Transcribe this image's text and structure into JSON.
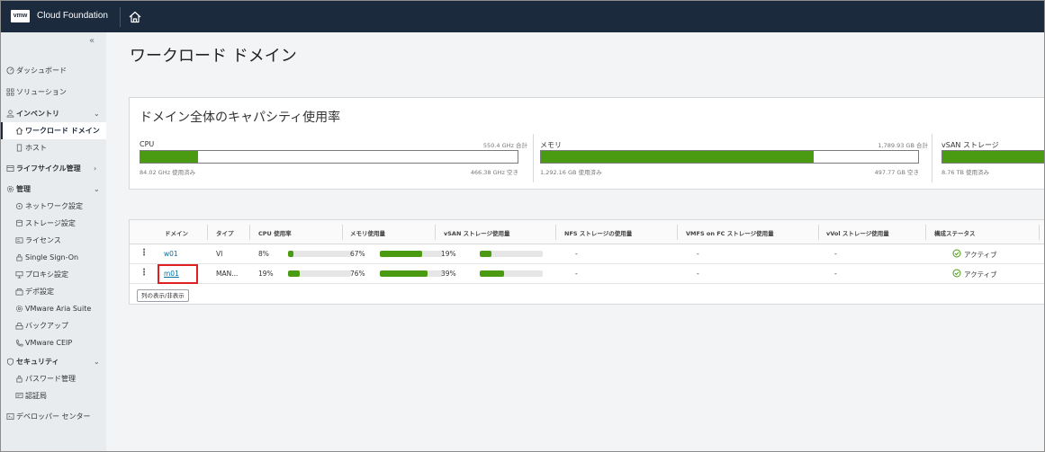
{
  "header": {
    "logo_text": "vmw",
    "app_title": "Cloud Foundation",
    "home_icon": "home-icon"
  },
  "sidebar": {
    "collapse_glyph": "«",
    "items": [
      {
        "label": "ダッシュボード",
        "icon": "dashboard-icon"
      },
      {
        "label": "ソリューション",
        "icon": "solutions-icon"
      },
      {
        "label": "インベントリ",
        "icon": "inventory-icon"
      },
      {
        "label": "ワークロード ドメイン",
        "icon": "workload-domain-icon"
      },
      {
        "label": "ホスト",
        "icon": "host-icon"
      },
      {
        "label": "ライフサイクル管理",
        "icon": "lifecycle-icon"
      },
      {
        "label": "管理",
        "icon": "gear-icon"
      },
      {
        "label": "ネットワーク設定",
        "icon": "network-icon"
      },
      {
        "label": "ストレージ設定",
        "icon": "storage-icon"
      },
      {
        "label": "ライセンス",
        "icon": "license-icon"
      },
      {
        "label": "Single Sign-On",
        "icon": "sso-icon"
      },
      {
        "label": "プロキシ設定",
        "icon": "proxy-icon"
      },
      {
        "label": "デポ設定",
        "icon": "depot-icon"
      },
      {
        "label": "VMware Aria Suite",
        "icon": "aria-icon"
      },
      {
        "label": "バックアップ",
        "icon": "backup-icon"
      },
      {
        "label": "VMware CEIP",
        "icon": "ceip-icon"
      },
      {
        "label": "セキュリティ",
        "icon": "shield-icon"
      },
      {
        "label": "パスワード管理",
        "icon": "lock-icon"
      },
      {
        "label": "認証局",
        "icon": "certificate-icon"
      },
      {
        "label": "デベロッパー センター",
        "icon": "developer-icon"
      }
    ]
  },
  "main": {
    "page_title": "ワークロード ドメイン",
    "capacity": {
      "title": "ドメイン全体のキャパシティ使用率",
      "cpu": {
        "label": "CPU",
        "total": "550.4 GHz 合計",
        "used": "84.02 GHz 使用済み",
        "free": "466.38 GHz 空き",
        "fraction": 0.153
      },
      "memory": {
        "label": "メモリ",
        "total": "1,789.93 GB 合計",
        "used": "1,292.16 GB 使用済み",
        "free": "497.77 GB 空き",
        "fraction": 0.722
      },
      "vsan": {
        "label": "vSAN ストレージ",
        "used": "8.76 TB 使用済み",
        "fraction": 0.3
      }
    },
    "table": {
      "columns": [
        "ドメイン",
        "タイプ",
        "CPU 使用率",
        "メモリ使用量",
        "vSAN ストレージ使用量",
        "NFS ストレージの使用量",
        "VMFS on FC ストレージ使用量",
        "vVol ストレージ使用量",
        "構成ステータス"
      ],
      "rows": [
        {
          "domain": "w01",
          "type": "VI",
          "cpu": "8%",
          "cpu_fraction": 0.08,
          "mem": "67%",
          "mem_fraction": 0.67,
          "vsan": "19%",
          "vsan_fraction": 0.19,
          "nfs": "-",
          "vmfs": "-",
          "vvol": "-",
          "status": "アクティブ"
        },
        {
          "domain": "m01",
          "type": "MAN...",
          "cpu": "19%",
          "cpu_fraction": 0.19,
          "mem": "76%",
          "mem_fraction": 0.76,
          "vsan": "39%",
          "vsan_fraction": 0.39,
          "nfs": "-",
          "vmfs": "-",
          "vvol": "-",
          "status": "アクティブ"
        }
      ],
      "toggle_columns_label": "列の表示/非表示"
    }
  },
  "colors": {
    "header_bg": "#1b2a3c",
    "accent_green": "#4a9b12",
    "link": "#0072a3",
    "highlight": "#e02020",
    "sidebar_bg": "#e8ecef"
  }
}
